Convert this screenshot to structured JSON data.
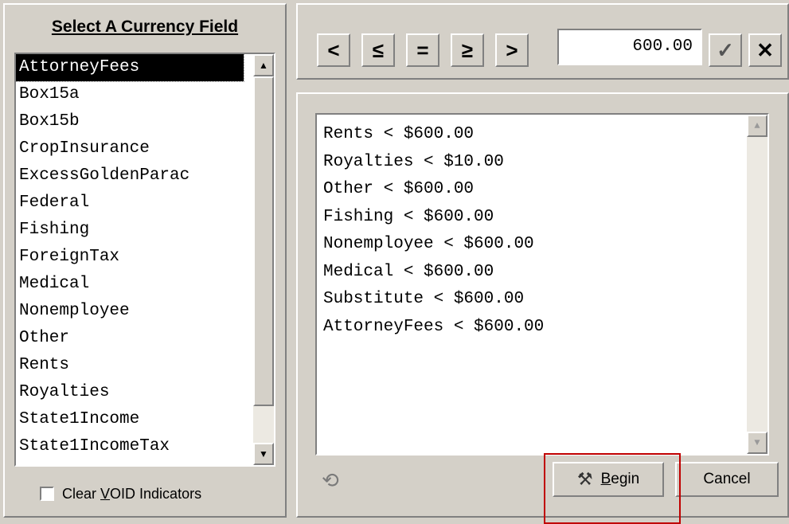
{
  "left_panel": {
    "title": "Select A Currency Field",
    "fields": [
      "AttorneyFees",
      "Box15a",
      "Box15b",
      "CropInsurance",
      "ExcessGoldenParac",
      "Federal",
      "Fishing",
      "ForeignTax",
      "Medical",
      "Nonemployee",
      "Other",
      "Rents",
      "Royalties",
      "State1Income",
      "State1IncomeTax"
    ],
    "selected_index": 0,
    "clear_void_label_pre": "Clear ",
    "clear_void_label_access": "V",
    "clear_void_label_post": "OID Indicators",
    "clear_void_checked": false
  },
  "toolbar": {
    "buttons": [
      {
        "name": "less-than-button",
        "glyph": "<"
      },
      {
        "name": "less-equal-button",
        "glyph": "≤"
      },
      {
        "name": "equal-button",
        "glyph": "="
      },
      {
        "name": "greater-equal-button",
        "glyph": "≥"
      },
      {
        "name": "greater-than-button",
        "glyph": ">"
      }
    ],
    "value": "600.00",
    "confirm_icon": "check-icon",
    "delete_icon": "close-icon"
  },
  "criteria": {
    "lines": [
      "Rents < $600.00",
      "Royalties < $10.00",
      "Other < $600.00",
      "Fishing < $600.00",
      "Nonemployee < $600.00",
      "Medical < $600.00",
      "Substitute < $600.00",
      "AttorneyFees < $600.00"
    ]
  },
  "actions": {
    "begin_access": "B",
    "begin_rest": "egin",
    "cancel": "Cancel",
    "refresh_icon": "refresh-icon",
    "begin_icon": "wizard-icon",
    "highlight_color": "#c00000"
  }
}
